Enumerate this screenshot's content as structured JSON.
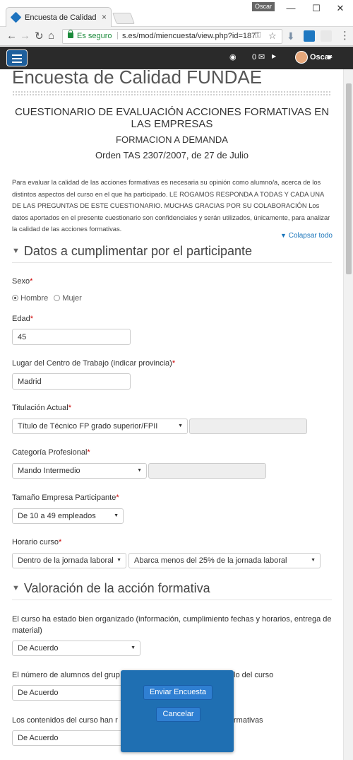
{
  "browser": {
    "tab_title": "Encuesta de Calidad FUNDAE",
    "tab_close": "×",
    "profile_name": "Oscar",
    "window_controls": [
      "—",
      "☐",
      "✕"
    ],
    "nav": {
      "back": "←",
      "forward": "→",
      "reload": "↻",
      "home": "⌂"
    },
    "secure_label": "Es seguro",
    "url": "s.es/mod/miencuesta/view.php?id=187",
    "icons": [
      "lock-icon",
      "key-icon",
      "star-icon",
      "download-icon",
      "extension-s-icon",
      "extension-m-icon",
      "menu-dots-icon"
    ]
  },
  "moodle_nav": {
    "message_count": "0",
    "user_name": "Oscar",
    "accent_color": "#1e5f9c"
  },
  "page": {
    "title": "Encuesta de Calidad FUNDAE",
    "heading": "CUESTIONARIO DE EVALUACIÓN ACCIONES FORMATIVAS EN LAS EMPRESAS",
    "subheading": "FORMACION A DEMANDA",
    "order": "Orden TAS 2307/2007, de 27 de Julio",
    "intro": "Para evaluar la calidad de las acciones formativas es necesaria su opinión como alumno/a, acerca de los distintos aspectos del curso en el que ha participado. LE ROGAMOS RESPONDA A TODAS Y CADA UNA DE LAS PREGUNTAS DE ESTE CUESTIONARIO. MUCHAS GRACIAS POR SU COLABORACIÓN Los datos aportados en el presente cuestionario son confidenciales y serán utilizados, únicamente, para analizar la calidad de las acciones formativas.",
    "collapse_all": "Colapsar todo"
  },
  "section1": {
    "title": "Datos a cumplimentar por el participante",
    "sexo_label": "Sexo",
    "sexo_options": [
      "Hombre",
      "Mujer"
    ],
    "sexo_selected": "Hombre",
    "edad_label": "Edad",
    "edad_value": "45",
    "lugar_label": "Lugar del Centro de Trabajo (indicar provincia)",
    "lugar_value": "Madrid",
    "titulacion_label": "Titulación Actual",
    "titulacion_value": "Título de Técnico FP grado superior/FPII",
    "categoria_label": "Categoría Profesional",
    "categoria_value": "Mando Intermedio",
    "tamano_label": "Tamaño Empresa Participante",
    "tamano_value": "De 10 a 49 empleados",
    "horario_label": "Horario curso",
    "horario_value1": "Dentro de la jornada laboral",
    "horario_value2": "Abarca menos del 25% de la jornada laboral",
    "required_mark": "*"
  },
  "section2": {
    "title": "Valoración de la acción formativa",
    "q1": "El curso ha estado bien organizado (información, cumplimiento fechas y horarios, entrega de material)",
    "q1_value": "De Acuerdo",
    "q2_left": "El número de alumnos del grup",
    "q2_right": "arrollo del curso",
    "q2_value": "De Acuerdo",
    "q3_left": "Los contenidos del curso han r",
    "q3_right": "rmativas",
    "q3_value": "De Acuerdo"
  },
  "actions": {
    "submit": "Enviar Encuesta",
    "cancel": "Cancelar"
  }
}
